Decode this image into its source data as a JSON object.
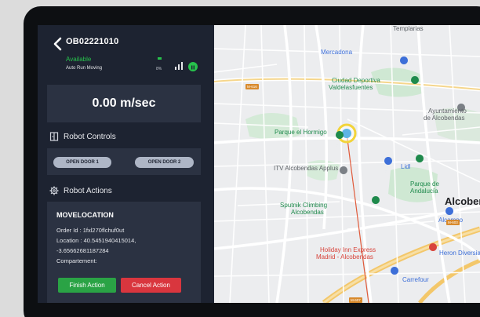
{
  "robot": {
    "id": "OB02221010",
    "status": "Available",
    "mode": "Auto Run Moving",
    "battery": "8%"
  },
  "speed": {
    "value": "0.00 m/sec"
  },
  "controls": {
    "title": "Robot Controls",
    "door1_label": "OPEN DOOR 1",
    "door2_label": "OPEN DOOR 2"
  },
  "actions": {
    "title": "Robot Actions",
    "name": "MOVELOCATION",
    "order_id": "Order Id : 1fxl270flchuf0ut",
    "location_line1": "Location : 40.5451940415014,",
    "location_line2": "-3.65662681187284",
    "compartment": "Compartement:",
    "finish_label": "Finish Action",
    "cancel_label": "Cancel Action"
  },
  "map": {
    "labels": {
      "top": "Templarias",
      "mercadona": "Mercadona",
      "ciudad1": "Ciudad Deportiva",
      "ciudad2": "Valdelasfuentes",
      "ayto1": "Ayuntamiento",
      "ayto2": "de Alcobendas",
      "parque_hormigo": "Parque el Hormigo",
      "itv": "ITV Alcobendas Applus",
      "lidl": "Lidl",
      "parque_and1": "Parque de",
      "parque_and2": "Andalucía",
      "sputnik1": "Sputnik Climbing",
      "sputnik2": "Alcobendas",
      "alcobendas": "Alcoben",
      "alcampo": "Alcampo",
      "holiday1": "Holiday Inn Express",
      "holiday2": "Madrid - Alcobendas",
      "heron": "Heron Diversia",
      "carrefour": "Carrefour"
    },
    "road_tags": {
      "m616": "M-616",
      "m603": "M-603",
      "m607": "M-607"
    }
  },
  "colors": {
    "panel_bg": "#1d2331",
    "card_bg": "#2b3242",
    "status_green": "#27c24c",
    "finish_green": "#2aa345",
    "cancel_red": "#d9363e",
    "door_button": "#aeb6c6",
    "robot_marker": "#f2d43a",
    "route_line": "#e05a3a"
  }
}
